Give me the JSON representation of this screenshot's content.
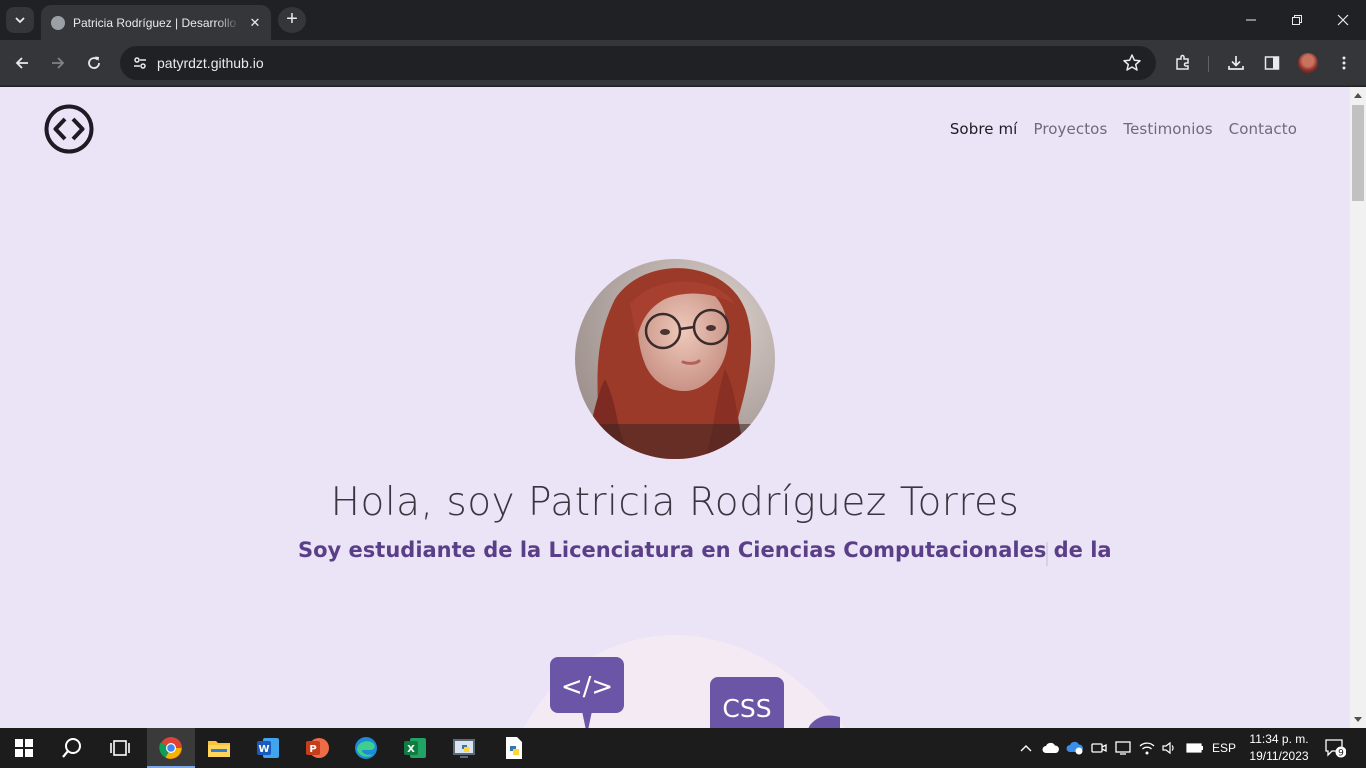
{
  "browser": {
    "tab_title": "Patricia Rodríguez | Desarrollo",
    "tab_close": "✕",
    "new_tab": "+",
    "url": "patyrdzt.github.io"
  },
  "page": {
    "nav": [
      "Sobre mí",
      "Proyectos",
      "Testimonios",
      "Contacto"
    ],
    "active_nav": "Sobre mí",
    "hero_title": "Hola, soy Patricia Rodríguez Torres",
    "hero_subtitle": "Soy estudiante de la Licenciatura en Ciencias Computacionales de la",
    "illustration_labels": [
      "</>",
      "CSS"
    ],
    "colors": {
      "background": "#ebe3f6",
      "accent": "#5a3f88",
      "bubble": "#6b55a6"
    }
  },
  "taskbar": {
    "apps": [
      "windows-start-icon",
      "search-icon",
      "task-view-icon",
      "chrome-icon",
      "file-explorer-icon",
      "word-icon",
      "powerpoint-icon",
      "edge-icon",
      "excel-icon",
      "python-idle-icon",
      "python-file-icon"
    ],
    "language": "ESP",
    "time": "11:34 p. m.",
    "date": "19/11/2023",
    "notification_count": "9"
  }
}
